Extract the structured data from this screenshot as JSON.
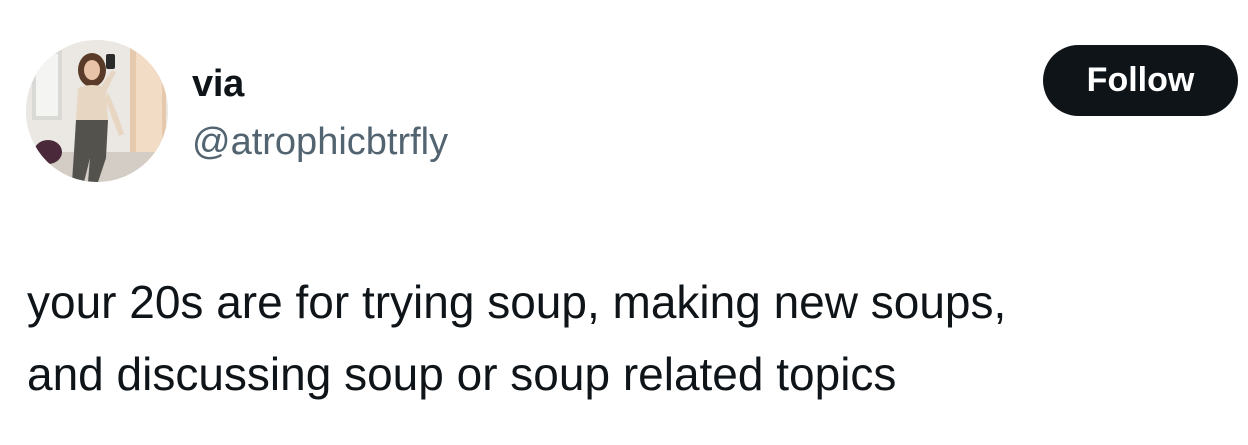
{
  "author": {
    "display_name": "via",
    "handle": "@atrophicbtrfly",
    "avatar_icon": "profile-photo"
  },
  "follow_button": {
    "label": "Follow"
  },
  "tweet": {
    "text": "your 20s are for trying soup, making new soups,\nand discussing soup or soup related topics"
  },
  "colors": {
    "text": "#0f1419",
    "handle": "#536471",
    "button_bg": "#0f1419",
    "button_text": "#ffffff",
    "background": "#ffffff"
  }
}
